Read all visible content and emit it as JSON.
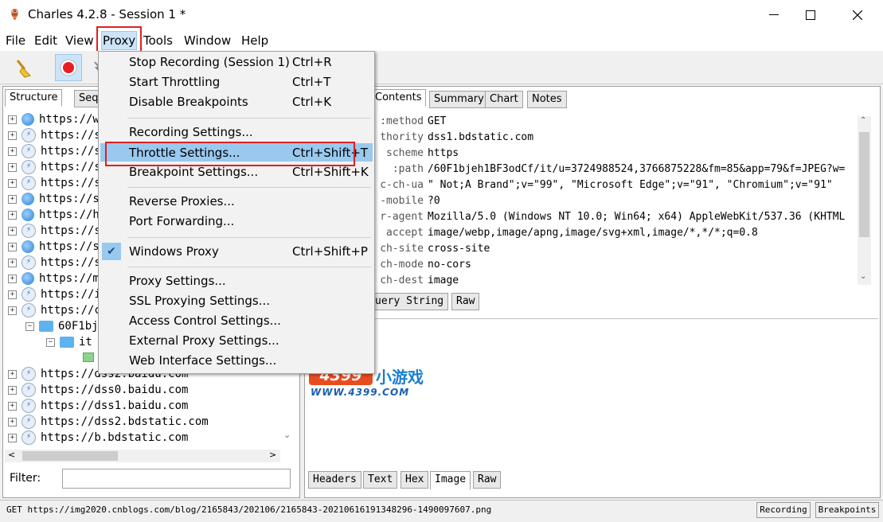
{
  "window": {
    "title": "Charles 4.2.8 - Session 1 *"
  },
  "menubar": [
    "File",
    "Edit",
    "View",
    "Proxy",
    "Tools",
    "Window",
    "Help"
  ],
  "left_tabs": [
    "Structure",
    "Seq"
  ],
  "tree": [
    {
      "icon": "globe",
      "text": "https://w"
    },
    {
      "icon": "bolt",
      "text": "https://s"
    },
    {
      "icon": "bolt",
      "text": "https://s"
    },
    {
      "icon": "bolt",
      "text": "https://s"
    },
    {
      "icon": "bolt",
      "text": "https://s"
    },
    {
      "icon": "globe",
      "text": "https://s"
    },
    {
      "icon": "globe",
      "text": "https://h"
    },
    {
      "icon": "bolt",
      "text": "https://s"
    },
    {
      "icon": "globe",
      "text": "https://s"
    },
    {
      "icon": "bolt",
      "text": "https://s"
    },
    {
      "icon": "globe",
      "text": "https://m"
    },
    {
      "icon": "bolt",
      "text": "https://i"
    },
    {
      "icon": "bolt",
      "text": "https://c"
    }
  ],
  "tree_children": [
    {
      "text": "60F1bj"
    },
    {
      "text": "it"
    }
  ],
  "tree_after": [
    {
      "icon": "bolt",
      "text": "https://dss2.baidu.com"
    },
    {
      "icon": "bolt",
      "text": "https://dss0.baidu.com"
    },
    {
      "icon": "bolt",
      "text": "https://dss1.baidu.com"
    },
    {
      "icon": "bolt",
      "text": "https://dss2.bdstatic.com"
    },
    {
      "icon": "bolt",
      "text": "https://b.bdstatic.com"
    }
  ],
  "filter": {
    "label": "Filter:",
    "value": ""
  },
  "right_tabs": [
    "Contents",
    "Summary",
    "Chart",
    "Notes"
  ],
  "request_headers": [
    {
      "key": ":method",
      "value": "GET"
    },
    {
      "key": "thority",
      "value": "dss1.bdstatic.com"
    },
    {
      "key": "scheme",
      "value": "https"
    },
    {
      "key": ":path",
      "value": "/60F1bjeh1BF3odCf/it/u=3724988524,3766875228&fm=85&app=79&f=JPEG?w="
    },
    {
      "key": "c-ch-ua",
      "value": "\" Not;A Brand\";v=\"99\", \"Microsoft Edge\";v=\"91\", \"Chromium\";v=\"91\""
    },
    {
      "key": "-mobile",
      "value": "?0"
    },
    {
      "key": "r-agent",
      "value": "Mozilla/5.0 (Windows NT 10.0; Win64; x64) AppleWebKit/537.36 (KHTML"
    },
    {
      "key": "accept",
      "value": "image/webp,image/apng,image/svg+xml,image/*,*/*;q=0.8"
    },
    {
      "key": "ch-site",
      "value": "cross-site"
    },
    {
      "key": "ch-mode",
      "value": "no-cors"
    },
    {
      "key": "ch-dest",
      "value": "image"
    }
  ],
  "req_bottom_tabs": [
    "uery String",
    "Raw"
  ],
  "logo": {
    "brand": "4399",
    "cn": "小游戏",
    "url": "WWW.4399.COM"
  },
  "resp_tabs": [
    "Headers",
    "Text",
    "Hex",
    "Image",
    "Raw"
  ],
  "proxy_menu": [
    {
      "label": "Stop Recording (Session 1)",
      "shortcut": "Ctrl+R"
    },
    {
      "label": "Start Throttling",
      "shortcut": "Ctrl+T"
    },
    {
      "label": "Disable Breakpoints",
      "shortcut": "Ctrl+K"
    },
    {
      "label": "Recording Settings...",
      "shortcut": ""
    },
    {
      "label": "Throttle Settings...",
      "shortcut": "Ctrl+Shift+T"
    },
    {
      "label": "Breakpoint Settings...",
      "shortcut": "Ctrl+Shift+K"
    },
    {
      "label": "Reverse Proxies...",
      "shortcut": ""
    },
    {
      "label": "Port Forwarding...",
      "shortcut": ""
    },
    {
      "label": "Windows Proxy",
      "shortcut": "Ctrl+Shift+P"
    },
    {
      "label": "Proxy Settings...",
      "shortcut": ""
    },
    {
      "label": "SSL Proxying Settings...",
      "shortcut": ""
    },
    {
      "label": "Access Control Settings...",
      "shortcut": ""
    },
    {
      "label": "External Proxy Settings...",
      "shortcut": ""
    },
    {
      "label": "Web Interface Settings...",
      "shortcut": ""
    }
  ],
  "status": {
    "text": "GET https://img2020.cnblogs.com/blog/2165843/202106/2165843-20210616191348296-1490097607.png",
    "recording": "Recording",
    "breakpoints": "Breakpoints"
  },
  "colors": {
    "highlight": "#99c9ef",
    "annotation": "#e02020",
    "recording": "#e81e25"
  }
}
